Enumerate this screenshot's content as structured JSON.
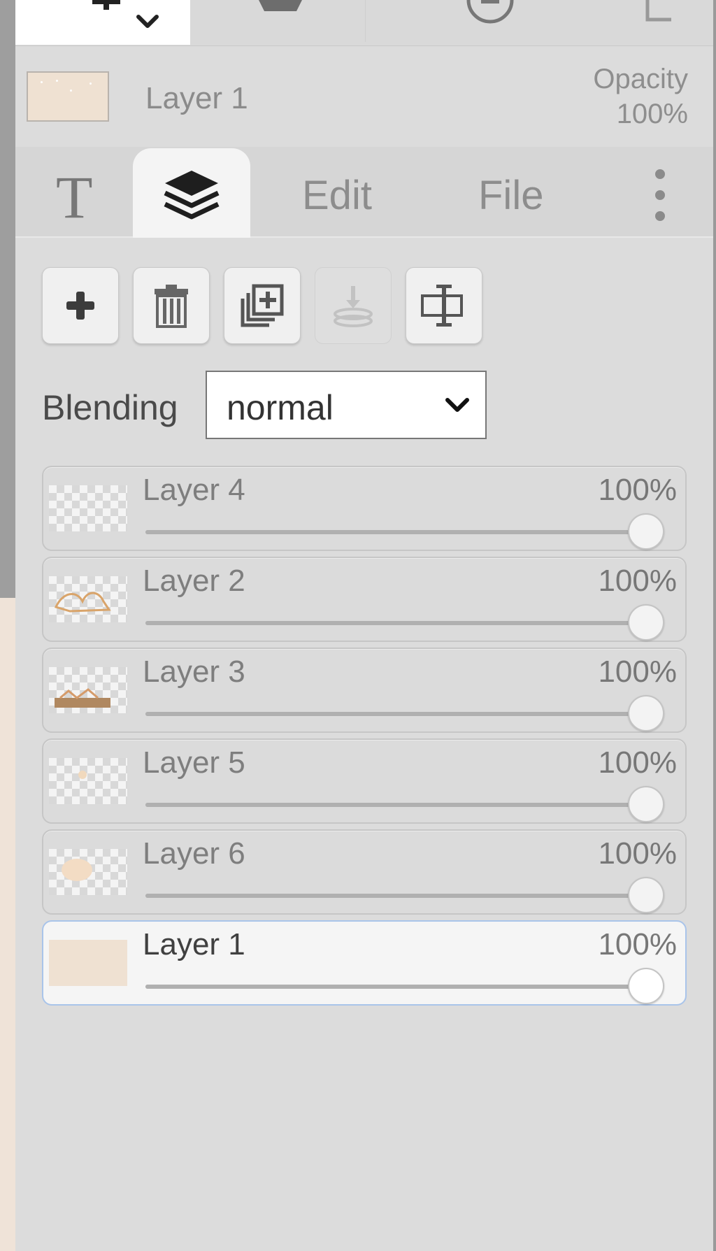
{
  "toolbar": {
    "tools": [
      {
        "icon": "text-tool-icon",
        "active": true,
        "has_dropdown": true
      },
      {
        "icon": "bucket-tool-icon",
        "active": false
      },
      {
        "icon": "minus-circle-tool-icon",
        "active": false
      },
      {
        "icon": "crop-tool-icon",
        "active": false
      }
    ]
  },
  "current_layer": {
    "name": "Layer 1",
    "opacity_label": "Opacity",
    "opacity_value": "100%"
  },
  "tabs": {
    "text_glyph": "T",
    "layers_icon": "layers-icon",
    "edit": "Edit",
    "file": "File",
    "more_icon": "more-vertical-icon",
    "active": "layers"
  },
  "actions": [
    {
      "name": "add-layer-button",
      "icon": "plus-icon",
      "enabled": true
    },
    {
      "name": "delete-layer-button",
      "icon": "trash-icon",
      "enabled": true
    },
    {
      "name": "duplicate-layer-button",
      "icon": "duplicate-icon",
      "enabled": true
    },
    {
      "name": "merge-down-button",
      "icon": "merge-down-icon",
      "enabled": false
    },
    {
      "name": "layer-properties-button",
      "icon": "text-cursor-box-icon",
      "enabled": true
    }
  ],
  "blending": {
    "label": "Blending",
    "value": "normal"
  },
  "layers": [
    {
      "name": "Layer 4",
      "opacity": "100%",
      "opacity_fraction": 1.0,
      "selected": false,
      "thumb": "transparent"
    },
    {
      "name": "Layer 2",
      "opacity": "100%",
      "opacity_fraction": 1.0,
      "selected": false,
      "thumb": "sketch"
    },
    {
      "name": "Layer 3",
      "opacity": "100%",
      "opacity_fraction": 1.0,
      "selected": false,
      "thumb": "base"
    },
    {
      "name": "Layer 5",
      "opacity": "100%",
      "opacity_fraction": 1.0,
      "selected": false,
      "thumb": "faint"
    },
    {
      "name": "Layer 6",
      "opacity": "100%",
      "opacity_fraction": 1.0,
      "selected": false,
      "thumb": "blob"
    },
    {
      "name": "Layer 1",
      "opacity": "100%",
      "opacity_fraction": 1.0,
      "selected": true,
      "thumb": "solid"
    }
  ],
  "colors": {
    "panel_bg": "#dcdcdc",
    "selected_border": "#a9c4ea",
    "canvas_color": "#efe3d8"
  }
}
